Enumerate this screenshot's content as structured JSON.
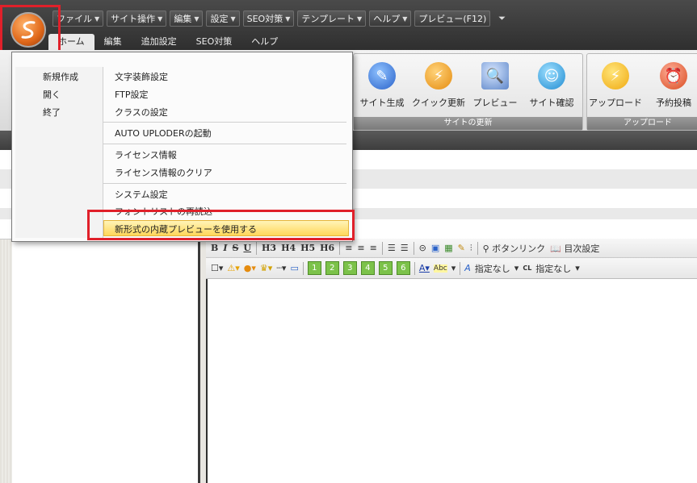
{
  "quick_access": [
    "ファイル",
    "サイト操作",
    "編集",
    "設定",
    "SEO対策",
    "テンプレート",
    "ヘルプ"
  ],
  "preview_label": "プレビュー(F12)",
  "ribbon_tabs": [
    "ホーム",
    "編集",
    "追加設定",
    "SEO対策",
    "ヘルプ"
  ],
  "ribbon": {
    "site_update_group": {
      "label": "サイトの更新",
      "buttons": [
        "サイト生成",
        "クイック更新",
        "プレビュー",
        "サイト確認"
      ]
    },
    "upload_group": {
      "label": "アップロード",
      "buttons": [
        "アップロード",
        "予約投稿"
      ]
    }
  },
  "menu": {
    "left_items": [
      "新規作成",
      "開く",
      "終了"
    ],
    "right_items": [
      "文字装飾設定",
      "FTP設定",
      "クラスの設定",
      "AUTO UPLODERの起動",
      "ライセンス情報",
      "ライセンス情報のクリア",
      "システム設定",
      "フォントリストの再読込",
      "新形式の内蔵プレビューを使用する"
    ]
  },
  "toolbar1": {
    "buttons": [
      "B",
      "I",
      "S",
      "U",
      "H3",
      "H4",
      "H5",
      "H6"
    ],
    "button_link": "ボタンリンク",
    "toc": "目次設定"
  },
  "toolbar2": {
    "numbers": [
      "1",
      "2",
      "3",
      "4",
      "5",
      "6"
    ],
    "abc": "Abc",
    "style_none_1": "指定なし",
    "style_none_2": "指定なし",
    "cl": "CL"
  }
}
